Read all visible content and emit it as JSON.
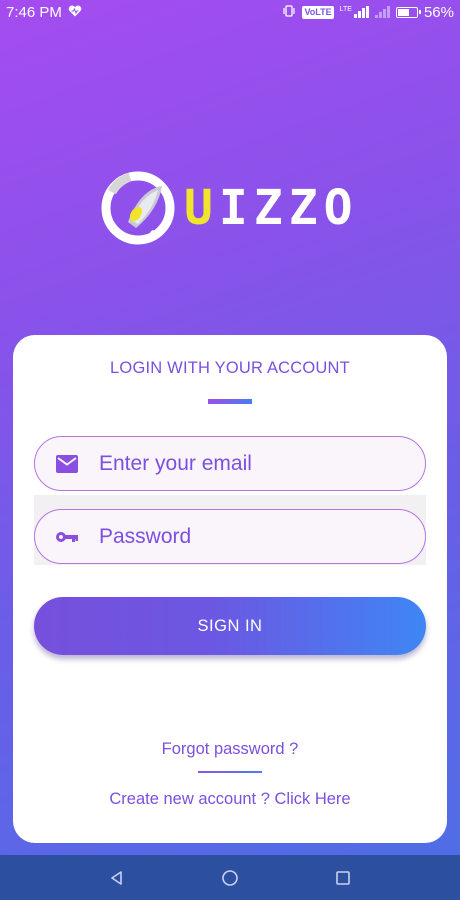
{
  "status_bar": {
    "time": "7:46 PM",
    "volte_label": "VoLTE",
    "lte_label": "LTE",
    "battery_percent": "56%",
    "battery_level": 0.56,
    "icons": [
      "heart-icon",
      "vibrate-icon",
      "signal-icon",
      "battery-icon"
    ]
  },
  "logo": {
    "text_highlight": "U",
    "text_rest": "IZZO",
    "accent_color": "#f1e52c"
  },
  "login": {
    "title": "LOGIN WITH YOUR ACCOUNT",
    "email_placeholder": "Enter your email",
    "password_placeholder": "Password",
    "sign_in_label": "SIGN IN",
    "forgot_label": "Forgot password ?",
    "create_label": "Create new account ? Click Here"
  },
  "nav_bar": {
    "icons": [
      "back-icon",
      "home-icon",
      "recents-icon"
    ]
  },
  "colors": {
    "accent": "#7c4fe0",
    "gradient_start": "#a54cf0",
    "gradient_end": "#4d6fe6",
    "button_end": "#3f86f4"
  }
}
